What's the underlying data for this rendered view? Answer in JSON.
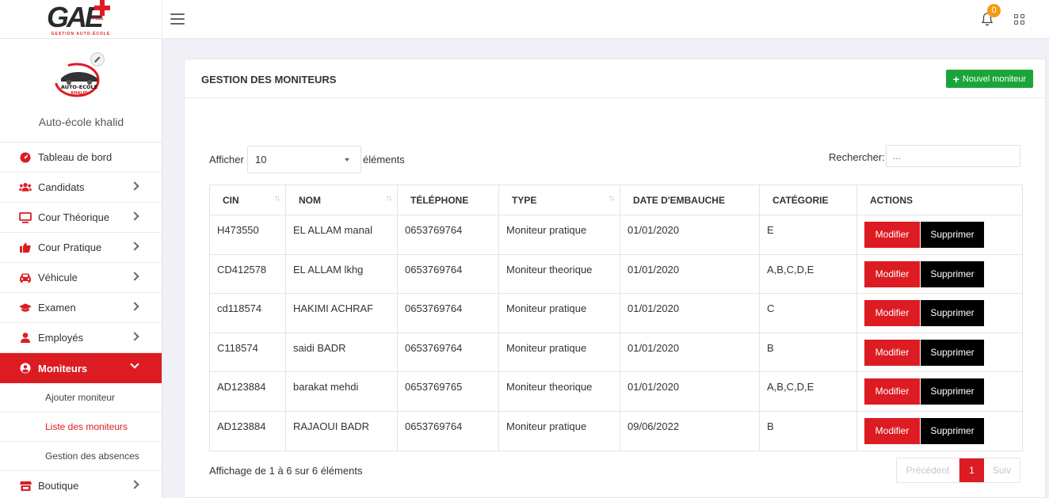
{
  "brand": {
    "logo_text": "GAE",
    "logo_plus_tag": "PLUS",
    "logo_subtitle": "GESTION AUTO-ÉCOLE"
  },
  "topbar": {
    "notification_count": "0"
  },
  "profile": {
    "school_name": "Auto-école khalid",
    "logo_line1": "AUTO-ECOLE",
    "logo_line2": "KHALID"
  },
  "sidebar": {
    "items": [
      {
        "label": "Tableau de bord",
        "icon": "dashboard-icon",
        "chevron": false
      },
      {
        "label": "Candidats",
        "icon": "users-icon",
        "chevron": true
      },
      {
        "label": "Cour Théorique",
        "icon": "monitor-icon",
        "chevron": true
      },
      {
        "label": "Cour Pratique",
        "icon": "thumbs-up-icon",
        "chevron": true
      },
      {
        "label": "Véhicule",
        "icon": "car-icon",
        "chevron": true
      },
      {
        "label": "Examen",
        "icon": "graduation-cap-icon",
        "chevron": true
      },
      {
        "label": "Employés",
        "icon": "user-icon",
        "chevron": true
      },
      {
        "label": "Moniteurs",
        "icon": "user-circle-icon",
        "chevron": true,
        "active": true
      }
    ],
    "sub_items": [
      {
        "label": "Ajouter moniteur"
      },
      {
        "label": "Liste des moniteurs",
        "current": true
      },
      {
        "label": "Gestion des absences"
      }
    ],
    "after_items": [
      {
        "label": "Boutique",
        "icon": "store-icon",
        "chevron": true
      }
    ]
  },
  "card": {
    "title": "GESTION DES MONITEURS",
    "new_button": "Nouvel moniteur"
  },
  "table_controls": {
    "show_label": "Afficher",
    "page_length": "10",
    "show_after": "éléments",
    "search_label": "Rechercher:",
    "search_placeholder": "..."
  },
  "table": {
    "columns": [
      {
        "label": "CIN",
        "sortable": true
      },
      {
        "label": "NOM",
        "sortable": true
      },
      {
        "label": "TÉLÉPHONE",
        "sortable": false
      },
      {
        "label": "TYPE",
        "sortable": true
      },
      {
        "label": "DATE D'EMBAUCHE",
        "sortable": false
      },
      {
        "label": "CATÉGORIE",
        "sortable": false
      },
      {
        "label": "ACTIONS",
        "sortable": false
      }
    ],
    "rows": [
      {
        "cin": "H473550",
        "nom": "EL ALLAM manal",
        "telephone": "0653769764",
        "type": "Moniteur pratique",
        "date": "01/01/2020",
        "categorie": "E"
      },
      {
        "cin": "CD412578",
        "nom": "EL ALLAM lkhg",
        "telephone": "0653769764",
        "type": "Moniteur theorique",
        "date": "01/01/2020",
        "categorie": "A,B,C,D,E"
      },
      {
        "cin": "cd118574",
        "nom": "HAKIMI ACHRAF",
        "telephone": "0653769764",
        "type": "Moniteur pratique",
        "date": "01/01/2020",
        "categorie": "C"
      },
      {
        "cin": "C118574",
        "nom": "saidi BADR",
        "telephone": "0653769764",
        "type": "Moniteur pratique",
        "date": "01/01/2020",
        "categorie": "B"
      },
      {
        "cin": "AD123884",
        "nom": "barakat mehdi",
        "telephone": "0653769765",
        "type": "Moniteur theorique",
        "date": "01/01/2020",
        "categorie": "A,B,C,D,E"
      },
      {
        "cin": "AD123884",
        "nom": "RAJAOUI BADR",
        "telephone": "0653769764",
        "type": "Moniteur pratique",
        "date": "09/06/2022",
        "categorie": "B"
      }
    ],
    "modify_label": "Modifier",
    "delete_label": "Supprimer"
  },
  "footer": {
    "info": "Affichage de 1 à 6 sur 6 éléments",
    "prev": "Précédent",
    "page": "1",
    "next": "Suiv"
  },
  "colors": {
    "accent": "#dc1c22",
    "success": "#1ba539",
    "badge": "#f39c12"
  }
}
